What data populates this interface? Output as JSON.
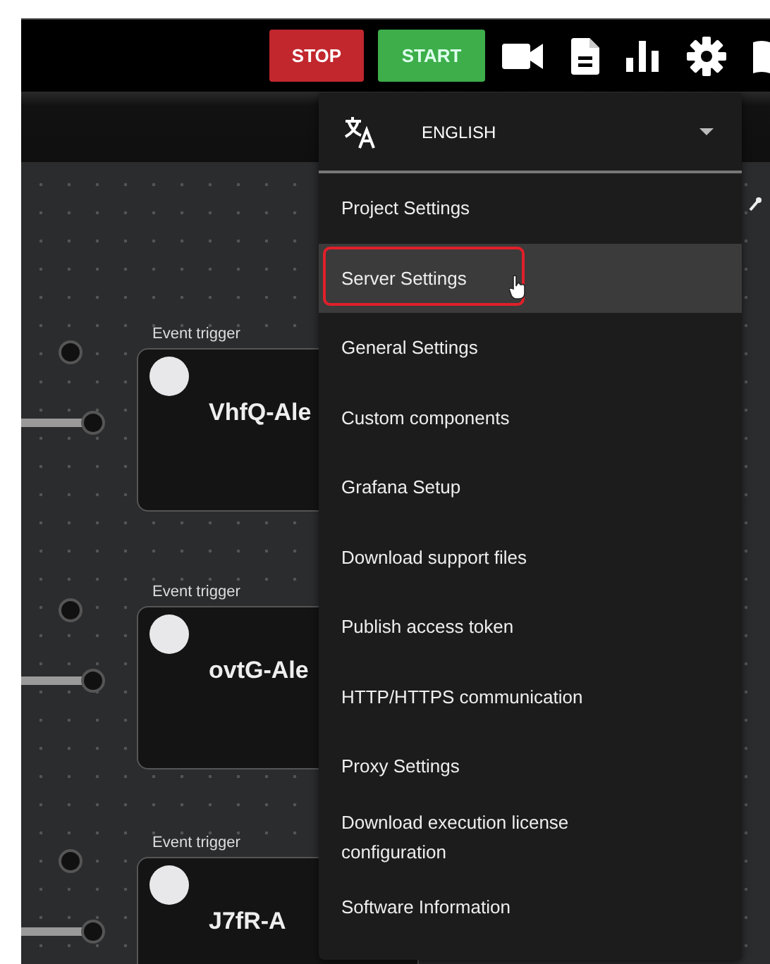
{
  "top_bar": {
    "buttons": [
      {
        "label": "STOP",
        "kind": "stop"
      },
      {
        "label": "START",
        "kind": "start"
      }
    ]
  },
  "canvas": {
    "nodes": [
      {
        "label": "Event trigger",
        "title": "VhfQ-Ale"
      },
      {
        "label": "Event trigger",
        "title": "ovtG-Ale"
      },
      {
        "label": "Event trigger",
        "title": "J7fR-A"
      }
    ]
  },
  "settings_menu": {
    "language": {
      "value": "ENGLISH"
    },
    "items": [
      {
        "label": "Project Settings",
        "selected": false
      },
      {
        "label": "Server Settings",
        "selected": true
      },
      {
        "label": "General Settings",
        "selected": false
      },
      {
        "label": "Custom components",
        "selected": false
      },
      {
        "label": "Grafana Setup",
        "selected": false
      },
      {
        "label": "Download support files",
        "selected": false
      },
      {
        "label": "Publish access token",
        "selected": false
      },
      {
        "label": "HTTP/HTTPS communication",
        "selected": false
      },
      {
        "label": "Proxy Settings",
        "selected": false
      },
      {
        "label": "Download execution license configuration",
        "selected": false
      },
      {
        "label": "Software Information",
        "selected": false
      }
    ]
  }
}
